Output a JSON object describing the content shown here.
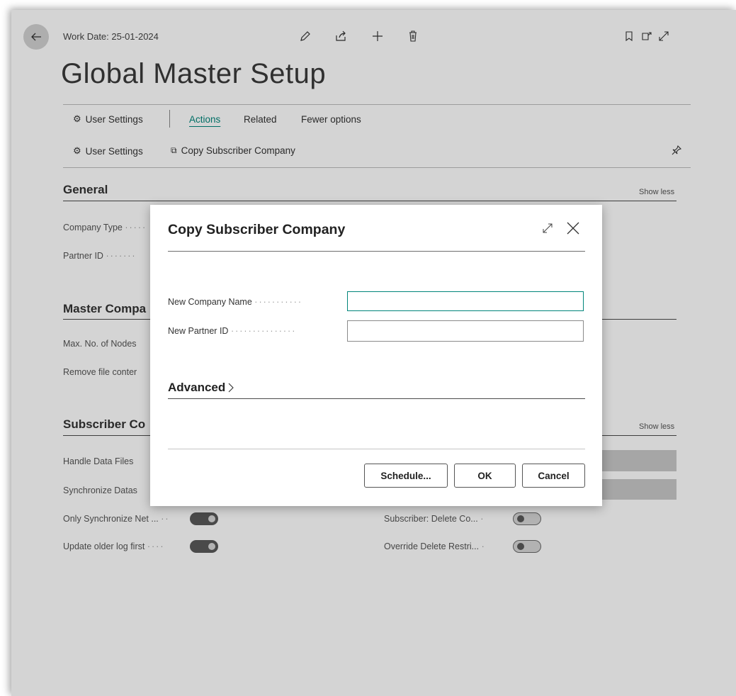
{
  "header": {
    "work_date": "Work Date: 25-01-2024",
    "title": "Global Master Setup"
  },
  "actionbar": {
    "tabs": [
      "User Settings",
      "Actions",
      "Related",
      "Fewer options"
    ],
    "actions": [
      "User Settings",
      "Copy Subscriber Company"
    ]
  },
  "sections": {
    "general": {
      "title": "General",
      "show_less": "Show less",
      "fields": [
        "Company Type",
        "Partner ID"
      ]
    },
    "master": {
      "title": "Master Compa",
      "fields": [
        "Max. No. of Nodes",
        "Remove file conter"
      ]
    },
    "subscriber": {
      "title": "Subscriber Co",
      "show_less": "Show less",
      "fields_left": [
        "Handle Data Files",
        "Synchronize Datas",
        "Only Synchronize Net ...",
        "Update older log first"
      ],
      "fields_right": [
        "Subscriber: Delete Co...",
        "Override Delete Restri..."
      ]
    }
  },
  "toggles": {
    "only_sync_net": true,
    "update_older_log_first": true,
    "subscriber_delete": false,
    "override_delete": false
  },
  "dialog": {
    "title": "Copy Subscriber Company",
    "new_company_name_label": "New Company Name",
    "new_company_name_value": "",
    "new_partner_id_label": "New Partner ID",
    "new_partner_id_value": "",
    "advanced": "Advanced",
    "buttons": [
      "Schedule...",
      "OK",
      "Cancel"
    ]
  },
  "colors": {
    "accent": "#00857a",
    "overlay": "rgba(0,0,0,0.17)"
  },
  "icons": [
    "back-arrow-icon",
    "edit-pencil-icon",
    "share-icon",
    "add-plus-icon",
    "delete-trash-icon",
    "bookmark-icon",
    "open-new-window-icon",
    "expand-icon",
    "user-settings-icon",
    "copy-company-icon",
    "pin-icon",
    "dialog-expand-icon",
    "close-icon",
    "chevron-right-icon"
  ]
}
